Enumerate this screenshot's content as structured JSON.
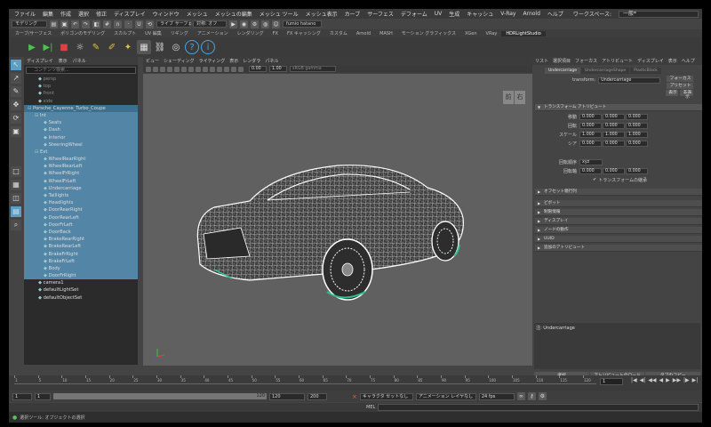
{
  "menubar": {
    "items": [
      "ファイル",
      "編集",
      "作成",
      "選択",
      "修正",
      "ディスプレイ",
      "ウィンドウ",
      "メッシュ",
      "メッシュの編集",
      "メッシュ ツール",
      "メッシュ表示",
      "カーブ",
      "サーフェス",
      "デフォーム",
      "UV",
      "生成",
      "キャッシュ",
      "V-Ray",
      "Arnold",
      "ヘルプ"
    ],
    "workspace_label": "ワークスペース:",
    "workspace_value": "一般*"
  },
  "statusline": {
    "mode": "モデリング",
    "symmetry": "対称: オフ",
    "live": "ライブ サーフェスなし",
    "user": "fumio hatano"
  },
  "shelf": {
    "tabs": [
      "カーブ/サーフェス",
      "ポリゴンのモデリング",
      "スカルプト",
      "UV 編集",
      "リギング",
      "アニメーション",
      "レンダリング",
      "FX",
      "FX キャッシング",
      "カスタム",
      "Arnold",
      "MASH",
      "モーション グラフィックス",
      "XGen",
      "VRay",
      "HDRLightStudio"
    ],
    "active": "HDRLightStudio"
  },
  "outliner": {
    "menu": [
      "ディスプレイ",
      "表示",
      "パネル"
    ],
    "search_placeholder": "コンテンツ検索...",
    "items": [
      {
        "label": "persp",
        "indent": 16,
        "state": "dim"
      },
      {
        "label": "top",
        "indent": 16,
        "state": "dim"
      },
      {
        "label": "front",
        "indent": 16,
        "state": "dim"
      },
      {
        "label": "side",
        "indent": 16,
        "state": "dim"
      },
      {
        "label": "Porsche_Cayenne_Turbo_Coupe",
        "indent": 4,
        "state": "hl"
      },
      {
        "label": "Int",
        "indent": 12,
        "state": "sel"
      },
      {
        "label": "Seats",
        "indent": 22,
        "state": "sel"
      },
      {
        "label": "Dash",
        "indent": 22,
        "state": "sel"
      },
      {
        "label": "Interior",
        "indent": 22,
        "state": "sel"
      },
      {
        "label": "SteeringWheel",
        "indent": 22,
        "state": "sel"
      },
      {
        "label": "Ext",
        "indent": 12,
        "state": "sel"
      },
      {
        "label": "WheelRearRight",
        "indent": 22,
        "state": "sel"
      },
      {
        "label": "WheelRearLeft",
        "indent": 22,
        "state": "sel"
      },
      {
        "label": "WheelFrRight",
        "indent": 22,
        "state": "sel"
      },
      {
        "label": "WheelFrLeft",
        "indent": 22,
        "state": "sel"
      },
      {
        "label": "Undercarriage",
        "indent": 22,
        "state": "sel"
      },
      {
        "label": "Taillights",
        "indent": 22,
        "state": "sel"
      },
      {
        "label": "Headlights",
        "indent": 22,
        "state": "sel"
      },
      {
        "label": "DoorRearRight",
        "indent": 22,
        "state": "sel"
      },
      {
        "label": "DoorRearLeft",
        "indent": 22,
        "state": "sel"
      },
      {
        "label": "DoorFrLeft",
        "indent": 22,
        "state": "sel"
      },
      {
        "label": "DoorBack",
        "indent": 22,
        "state": "sel"
      },
      {
        "label": "BrakeRearRight",
        "indent": 22,
        "state": "sel"
      },
      {
        "label": "BrakeRearLeft",
        "indent": 22,
        "state": "sel"
      },
      {
        "label": "BrakeFrRight",
        "indent": 22,
        "state": "sel"
      },
      {
        "label": "BrakeFrLeft",
        "indent": 22,
        "state": "sel"
      },
      {
        "label": "Body",
        "indent": 22,
        "state": "sel"
      },
      {
        "label": "DoorFrRight",
        "indent": 22,
        "state": "sel"
      },
      {
        "label": "camera1",
        "indent": 16,
        "state": "norm"
      },
      {
        "label": "defaultLightSet",
        "indent": 16,
        "state": "norm"
      },
      {
        "label": "defaultObjectSet",
        "indent": 16,
        "state": "norm"
      }
    ]
  },
  "viewport": {
    "menu": [
      "ビュー",
      "シェーディング",
      "ライティング",
      "表示",
      "レンダラ",
      "パネル"
    ],
    "gamma": "0.00",
    "exposure": "1.00",
    "colorspace": "sRGB gamma",
    "camera": "persp",
    "cube_front": "前",
    "cube_right": "右"
  },
  "attr": {
    "menu": [
      "リスト",
      "選択項目",
      "フォーカス",
      "アトリビュート",
      "ディスプレイ",
      "表示",
      "ヘルプ"
    ],
    "tabs": [
      "Undercarriage",
      "UndercarriageShape",
      "PlasticBlack"
    ],
    "transform_label": "transform:",
    "transform_value": "Undercarriage",
    "focus": "フォーカス",
    "preset": "プリセット",
    "show": "表示",
    "hide": "非表示",
    "section_transform": "トランスフォーム アトリビュート",
    "rows": [
      {
        "label": "移動",
        "v": [
          "0.000",
          "0.000",
          "0.000"
        ]
      },
      {
        "label": "回転",
        "v": [
          "0.000",
          "0.000",
          "0.000"
        ]
      },
      {
        "label": "スケール",
        "v": [
          "1.000",
          "1.000",
          "1.000"
        ]
      },
      {
        "label": "シア",
        "v": [
          "0.000",
          "0.000",
          "0.000"
        ]
      }
    ],
    "rotorder_label": "回転順序",
    "rotorder": "xyz",
    "rotaxis_label": "回転軸",
    "rotaxis": [
      "0.000",
      "0.000",
      "0.000"
    ],
    "inherit": "トランスフォームの継承",
    "pivot": "オフセット親行列",
    "sections": [
      "ピボット",
      "制限情報",
      "ディスプレイ",
      "ノードの動作",
      "UUID",
      "追加のアトリビュート"
    ],
    "notes": "注: Undercarriage",
    "buttons": [
      "選択",
      "アトリビュートのロード",
      "タブのコピー"
    ]
  },
  "timeline": {
    "ticks": [
      "1",
      "5",
      "10",
      "15",
      "20",
      "25",
      "30",
      "35",
      "40",
      "45",
      "50",
      "55",
      "60",
      "65",
      "70",
      "75",
      "80",
      "85",
      "90",
      "95",
      "100",
      "105",
      "110",
      "115",
      "120"
    ],
    "current": "1"
  },
  "range": {
    "start": "1",
    "inner_start": "1",
    "inner_end": "120",
    "end": "120",
    "out": "200",
    "character_set": "キャラクタ セットなし",
    "anim_layer": "アニメーション レイヤなし",
    "fps": "24 fps"
  },
  "cmd": {
    "lang": "MEL"
  },
  "help": {
    "text": "選択ツール: オブジェクトの選択"
  }
}
